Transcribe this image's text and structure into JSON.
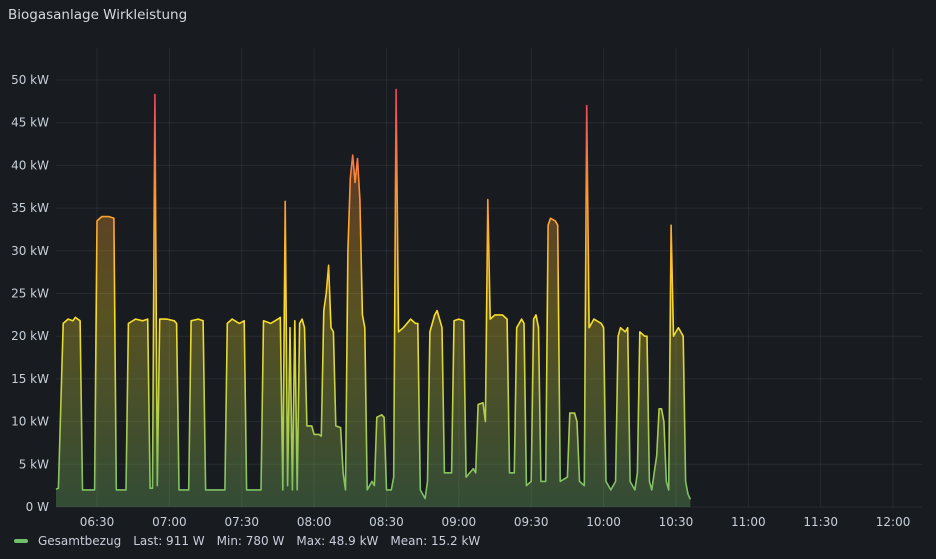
{
  "panel": {
    "title": "Biogasanlage Wirkleistung"
  },
  "legend": {
    "series": "Gesamtbezug",
    "last": "Last: 911 W",
    "min": "Min: 780 W",
    "max": "Max: 48.9 kW",
    "mean": "Mean: 15.2 kW"
  },
  "colors": {
    "background": "#181b1f",
    "series_green": "#73bf69",
    "series_yellow": "#fade2a",
    "series_orange": "#ff9830",
    "series_red": "#f2495c"
  },
  "chart_data": {
    "type": "area",
    "title": "Biogasanlage Wirkleistung",
    "xlabel": "",
    "ylabel": "",
    "ylim": [
      0,
      50
    ],
    "y_unit": "kW",
    "y_ticks": [
      "0 W",
      "5 kW",
      "10 kW",
      "15 kW",
      "20 kW",
      "25 kW",
      "30 kW",
      "35 kW",
      "40 kW",
      "45 kW",
      "50 kW"
    ],
    "x_ticks": [
      "06:30",
      "07:00",
      "07:30",
      "08:00",
      "08:30",
      "09:00",
      "09:30",
      "10:00",
      "10:30",
      "11:00",
      "11:30",
      "12:00"
    ],
    "x_range": [
      "06:13",
      "12:12"
    ],
    "grid": true,
    "legend_position": "bottom-left",
    "series": [
      {
        "name": "Gesamtbezug",
        "points": [
          [
            "06:13",
            2.1
          ],
          [
            "06:14",
            2.2
          ],
          [
            "06:16",
            21.5
          ],
          [
            "06:18",
            22.0
          ],
          [
            "06:20",
            21.8
          ],
          [
            "06:21",
            22.2
          ],
          [
            "06:23",
            21.8
          ],
          [
            "06:24",
            2.0
          ],
          [
            "06:29",
            2.0
          ],
          [
            "06:30",
            33.5
          ],
          [
            "06:32",
            34.0
          ],
          [
            "06:35",
            34.0
          ],
          [
            "06:37",
            33.8
          ],
          [
            "06:38",
            2.0
          ],
          [
            "06:42",
            2.0
          ],
          [
            "06:43",
            21.5
          ],
          [
            "06:46",
            22.0
          ],
          [
            "06:49",
            21.8
          ],
          [
            "06:51",
            22.0
          ],
          [
            "06:52",
            2.2
          ],
          [
            "06:53",
            2.2
          ],
          [
            "06:54",
            48.3
          ],
          [
            "06:55",
            2.5
          ],
          [
            "06:56",
            22.0
          ],
          [
            "06:59",
            22.0
          ],
          [
            "07:02",
            21.8
          ],
          [
            "07:03",
            21.5
          ],
          [
            "07:04",
            2.0
          ],
          [
            "07:08",
            2.0
          ],
          [
            "07:09",
            21.8
          ],
          [
            "07:12",
            22.0
          ],
          [
            "07:14",
            21.8
          ],
          [
            "07:15",
            2.0
          ],
          [
            "07:23",
            2.0
          ],
          [
            "07:24",
            21.5
          ],
          [
            "07:26",
            22.0
          ],
          [
            "07:29",
            21.5
          ],
          [
            "07:31",
            21.8
          ],
          [
            "07:32",
            2.0
          ],
          [
            "07:38",
            2.0
          ],
          [
            "07:39",
            21.8
          ],
          [
            "07:42",
            21.5
          ],
          [
            "07:45",
            22.0
          ],
          [
            "07:46",
            22.2
          ],
          [
            "07:47",
            2.0
          ],
          [
            "07:48",
            35.8
          ],
          [
            "07:49",
            2.5
          ],
          [
            "07:50",
            21.0
          ],
          [
            "07:51",
            2.0
          ],
          [
            "07:52",
            21.8
          ],
          [
            "07:53",
            2.0
          ],
          [
            "07:54",
            21.5
          ],
          [
            "07:55",
            22.0
          ],
          [
            "07:56",
            21.0
          ],
          [
            "07:57",
            9.5
          ],
          [
            "07:59",
            9.5
          ],
          [
            "08:00",
            8.5
          ],
          [
            "08:02",
            8.5
          ],
          [
            "08:03",
            8.3
          ],
          [
            "08:04",
            23.0
          ],
          [
            "08:05",
            25.0
          ],
          [
            "08:06",
            28.3
          ],
          [
            "08:07",
            21.0
          ],
          [
            "08:08",
            20.5
          ],
          [
            "08:09",
            9.5
          ],
          [
            "08:11",
            9.3
          ],
          [
            "08:12",
            4.0
          ],
          [
            "08:13",
            2.0
          ],
          [
            "08:14",
            30.0
          ],
          [
            "08:15",
            38.5
          ],
          [
            "08:16",
            41.2
          ],
          [
            "08:17",
            38.0
          ],
          [
            "08:18",
            40.8
          ],
          [
            "08:19",
            36.0
          ],
          [
            "08:20",
            22.5
          ],
          [
            "08:21",
            21.0
          ],
          [
            "08:22",
            2.0
          ],
          [
            "08:24",
            3.0
          ],
          [
            "08:25",
            2.5
          ],
          [
            "08:26",
            10.5
          ],
          [
            "08:28",
            10.8
          ],
          [
            "08:29",
            10.5
          ],
          [
            "08:30",
            2.0
          ],
          [
            "08:32",
            2.0
          ],
          [
            "08:33",
            3.5
          ],
          [
            "08:34",
            48.9
          ],
          [
            "08:35",
            20.5
          ],
          [
            "08:37",
            21.0
          ],
          [
            "08:40",
            22.0
          ],
          [
            "08:42",
            21.5
          ],
          [
            "08:43",
            21.5
          ],
          [
            "08:44",
            2.0
          ],
          [
            "08:46",
            1.0
          ],
          [
            "08:47",
            3.0
          ],
          [
            "08:48",
            20.5
          ],
          [
            "08:50",
            22.5
          ],
          [
            "08:51",
            23.0
          ],
          [
            "08:53",
            21.0
          ],
          [
            "08:54",
            4.0
          ],
          [
            "08:57",
            4.0
          ],
          [
            "08:58",
            21.8
          ],
          [
            "09:00",
            22.0
          ],
          [
            "09:02",
            21.8
          ],
          [
            "09:03",
            3.5
          ],
          [
            "09:06",
            4.5
          ],
          [
            "09:07",
            4.0
          ],
          [
            "09:08",
            12.0
          ],
          [
            "09:10",
            12.2
          ],
          [
            "09:11",
            10.0
          ],
          [
            "09:12",
            36.0
          ],
          [
            "09:13",
            22.0
          ],
          [
            "09:15",
            22.5
          ],
          [
            "09:18",
            22.5
          ],
          [
            "09:20",
            22.0
          ],
          [
            "09:21",
            4.0
          ],
          [
            "09:23",
            4.0
          ],
          [
            "09:24",
            21.0
          ],
          [
            "09:26",
            22.0
          ],
          [
            "09:27",
            21.5
          ],
          [
            "09:28",
            2.5
          ],
          [
            "09:30",
            3.0
          ],
          [
            "09:31",
            22.0
          ],
          [
            "09:32",
            22.5
          ],
          [
            "09:33",
            21.0
          ],
          [
            "09:34",
            3.0
          ],
          [
            "09:36",
            3.0
          ],
          [
            "09:37",
            33.0
          ],
          [
            "09:38",
            33.8
          ],
          [
            "09:40",
            33.5
          ],
          [
            "09:41",
            33.0
          ],
          [
            "09:42",
            3.0
          ],
          [
            "09:45",
            3.5
          ],
          [
            "09:46",
            11.0
          ],
          [
            "09:48",
            11.0
          ],
          [
            "09:49",
            10.0
          ],
          [
            "09:50",
            3.0
          ],
          [
            "09:52",
            2.5
          ],
          [
            "09:53",
            47.0
          ],
          [
            "09:54",
            21.0
          ],
          [
            "09:56",
            22.0
          ],
          [
            "09:59",
            21.5
          ],
          [
            "10:00",
            21.0
          ],
          [
            "10:01",
            3.0
          ],
          [
            "10:03",
            2.0
          ],
          [
            "10:05",
            3.0
          ],
          [
            "10:06",
            20.0
          ],
          [
            "10:07",
            21.0
          ],
          [
            "10:09",
            20.5
          ],
          [
            "10:10",
            21.0
          ],
          [
            "10:11",
            3.0
          ],
          [
            "10:13",
            2.0
          ],
          [
            "10:14",
            4.0
          ],
          [
            "10:15",
            20.5
          ],
          [
            "10:17",
            20.0
          ],
          [
            "10:18",
            20.0
          ],
          [
            "10:19",
            3.0
          ],
          [
            "10:20",
            2.0
          ],
          [
            "10:21",
            4.0
          ],
          [
            "10:22",
            6.0
          ],
          [
            "10:23",
            11.5
          ],
          [
            "10:24",
            11.5
          ],
          [
            "10:25",
            10.0
          ],
          [
            "10:26",
            3.0
          ],
          [
            "10:27",
            2.0
          ],
          [
            "10:28",
            33.0
          ],
          [
            "10:29",
            20.0
          ],
          [
            "10:30",
            20.5
          ],
          [
            "10:31",
            21.0
          ],
          [
            "10:32",
            20.5
          ],
          [
            "10:33",
            20.0
          ],
          [
            "10:34",
            3.0
          ],
          [
            "10:35",
            1.5
          ],
          [
            "10:36",
            0.9
          ]
        ]
      }
    ]
  }
}
